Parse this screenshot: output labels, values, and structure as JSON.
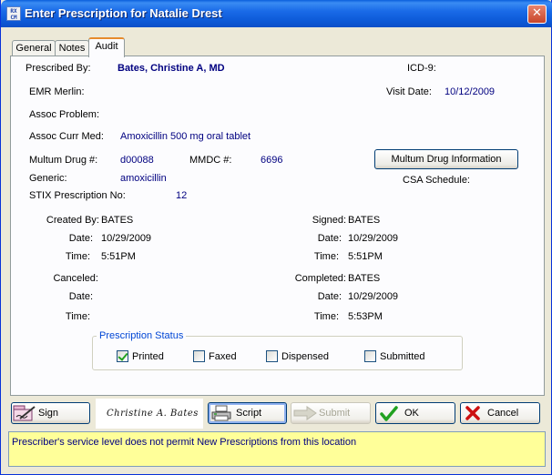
{
  "window": {
    "title": "Enter Prescription for Natalie Drest",
    "icon_text": "RX\nCM"
  },
  "tabs": [
    {
      "label": "General"
    },
    {
      "label": "Notes"
    },
    {
      "label": "Audit"
    }
  ],
  "audit": {
    "prescribed_by_label": "Prescribed By:",
    "prescribed_by": "Bates, Christine A, MD",
    "icd9_label": "ICD-9:",
    "emr_label": "EMR Merlin:",
    "visit_date_label": "Visit Date:",
    "visit_date": "10/12/2009",
    "assoc_problem_label": "Assoc Problem:",
    "assoc_curr_med_label": "Assoc Curr Med:",
    "assoc_curr_med": "Amoxicillin 500 mg oral tablet",
    "multum_drug_label": "Multum Drug #:",
    "multum_drug": "d00088",
    "mmdc_label": "MMDC #:",
    "mmdc": "6696",
    "multum_info_button": "Multum Drug Information",
    "generic_label": "Generic:",
    "generic": "amoxicillin",
    "csa_label": "CSA Schedule:",
    "stix_label": "STIX Prescription No:",
    "stix": "12",
    "created_by_label": "Created By:",
    "created_by": "BATES",
    "created_date_label": "Date:",
    "created_date": "10/29/2009",
    "created_time_label": "Time:",
    "created_time": "5:51PM",
    "signed_label": "Signed:",
    "signed_by": "BATES",
    "signed_date_label": "Date:",
    "signed_date": "10/29/2009",
    "signed_time_label": "Time:",
    "signed_time": "5:51PM",
    "canceled_label": "Canceled:",
    "canceled_date_label": "Date:",
    "canceled_time_label": "Time:",
    "completed_label": "Completed:",
    "completed_by": "BATES",
    "completed_date_label": "Date:",
    "completed_date": "10/29/2009",
    "completed_time_label": "Time:",
    "completed_time": "5:53PM"
  },
  "status_group": {
    "title": "Prescription Status",
    "printed": {
      "label": "Printed",
      "checked": true
    },
    "faxed": {
      "label": "Faxed",
      "checked": false
    },
    "dispensed": {
      "label": "Dispensed",
      "checked": false
    },
    "submitted": {
      "label": "Submitted",
      "checked": false
    }
  },
  "buttons": {
    "sign": "Sign",
    "script": "Script",
    "submit": "Submit",
    "ok": "OK",
    "cancel": "Cancel"
  },
  "signature": "Christine A. Bates",
  "status_message": "Prescriber's service level does not permit New Prescriptions from this location",
  "colors": {
    "titlebar": "#0b57d8",
    "value_text": "#000080",
    "status_bg": "#ffff99",
    "ok_check": "#21a121",
    "cancel_x": "#cc1111"
  }
}
